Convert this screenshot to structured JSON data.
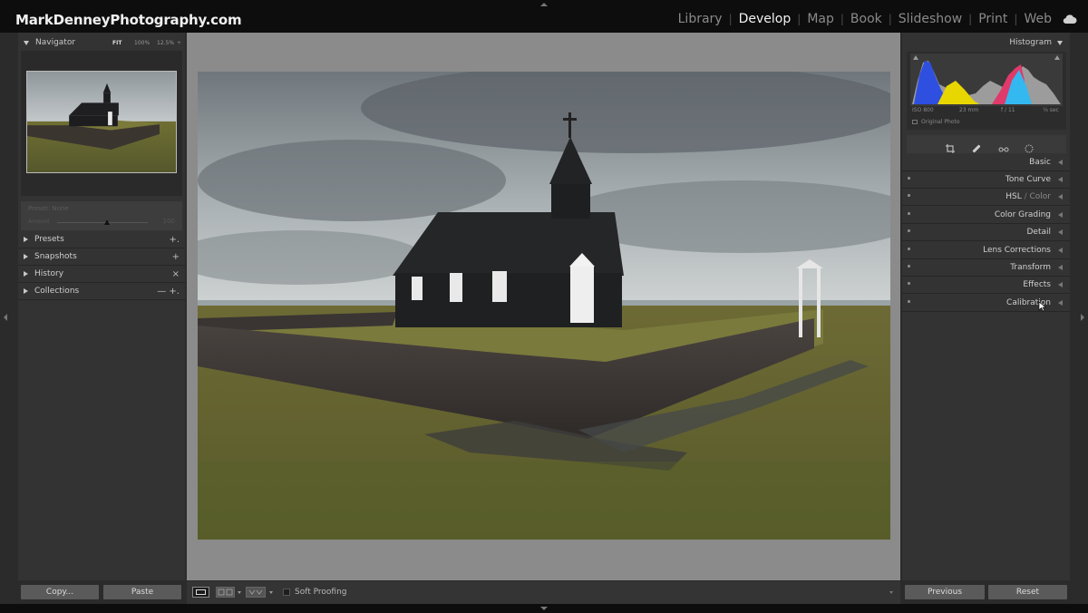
{
  "brand": "MarkDenneyPhotography.com",
  "modules": [
    {
      "label": "Library",
      "active": false
    },
    {
      "label": "Develop",
      "active": true
    },
    {
      "label": "Map",
      "active": false
    },
    {
      "label": "Book",
      "active": false
    },
    {
      "label": "Slideshow",
      "active": false
    },
    {
      "label": "Print",
      "active": false
    },
    {
      "label": "Web",
      "active": false
    }
  ],
  "module_separator": "|",
  "navigator": {
    "title": "Navigator",
    "zoom_fit": "FIT",
    "zoom_100": "100%",
    "zoom_custom": "12.5%",
    "zoom_arrows": "÷"
  },
  "preset_amount": {
    "label": "Preset: None",
    "slider_label": "Amount",
    "value": "100",
    "level_fraction": 0.55
  },
  "left_sections": [
    {
      "label": "Presets",
      "action": "+."
    },
    {
      "label": "Snapshots",
      "action": "+"
    },
    {
      "label": "History",
      "action": "×"
    },
    {
      "label": "Collections",
      "action": "— +."
    }
  ],
  "left_buttons": {
    "copy": "Copy...",
    "paste": "Paste"
  },
  "histogram": {
    "title": "Histogram",
    "iso": "ISO 800",
    "focal": "23 mm",
    "aperture": "f / 11",
    "shutter": "⅛ sec",
    "original_photo": "Original Photo"
  },
  "right_sections": [
    {
      "label": "Basic"
    },
    {
      "label": "Tone Curve"
    },
    {
      "label": "HSL",
      "label_b": "Color"
    },
    {
      "label": "Color Grading"
    },
    {
      "label": "Detail"
    },
    {
      "label": "Lens Corrections"
    },
    {
      "label": "Transform"
    },
    {
      "label": "Effects"
    },
    {
      "label": "Calibration"
    }
  ],
  "right_buttons": {
    "previous": "Previous",
    "reset": "Reset"
  },
  "toolbar": {
    "soft_proofing": "Soft Proofing"
  },
  "colors": {
    "active_module": "#f2f2f2",
    "inactive_module": "#8a8a8a",
    "panel_bg": "#333333",
    "canvas_bg": "#8b8b8b"
  }
}
